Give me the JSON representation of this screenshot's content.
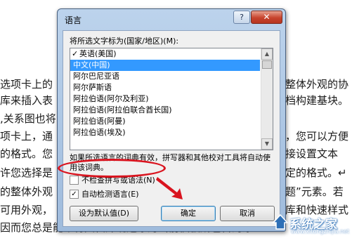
{
  "document": {
    "left_lines": [
      "选项卡上的",
      "库来插入表",
      ",关系图也将",
      "项卡上，通",
      "的格式。您",
      "许您选择是",
      "的整体外观",
      "可用外观，",
      "因而您总是能够将文档外观还原为当前模板所包含的原"
    ],
    "right_lines": [
      "整体外观的协",
      "档构建基块。 ",
      "",
      "，您可以方便",
      "接设置文本",
      "定的格式。↵",
      "题”元素。若",
      "库和快速样式"
    ]
  },
  "dialog": {
    "title": "语言",
    "help_label": "?",
    "close_label": "✕",
    "prompt": "将所选文字标为(国家/地区)(M):",
    "languages": [
      {
        "label": "英语(美国)",
        "checked": true
      },
      {
        "label": "中文(中国)",
        "selected": true
      },
      {
        "label": "阿尔巴尼亚语"
      },
      {
        "label": "阿尔萨斯语"
      },
      {
        "label": "阿拉伯语(阿尔及利亚)"
      },
      {
        "label": "阿拉伯语(阿拉伯联合酋长国)"
      },
      {
        "label": "阿拉伯语(阿曼)"
      },
      {
        "label": "阿拉伯语(埃及)"
      }
    ],
    "info_text": "如果所选语言的词典有效，拼写器和其他校对工具将自动使用该词典。",
    "no_proofing_label": "不检查拼写或语法(N)",
    "no_proofing_checked": false,
    "auto_detect_label": "自动检测语言(E)",
    "auto_detect_checked": true,
    "set_default_label": "设为默认值(D)",
    "ok_label": "确定",
    "cancel_label": "取消"
  },
  "watermark": {
    "text": "系统之家",
    "url": "www.xitongzhijia.net"
  },
  "colors": {
    "annotation_red": "#d9141f",
    "selection_blue": "#3399ff"
  }
}
